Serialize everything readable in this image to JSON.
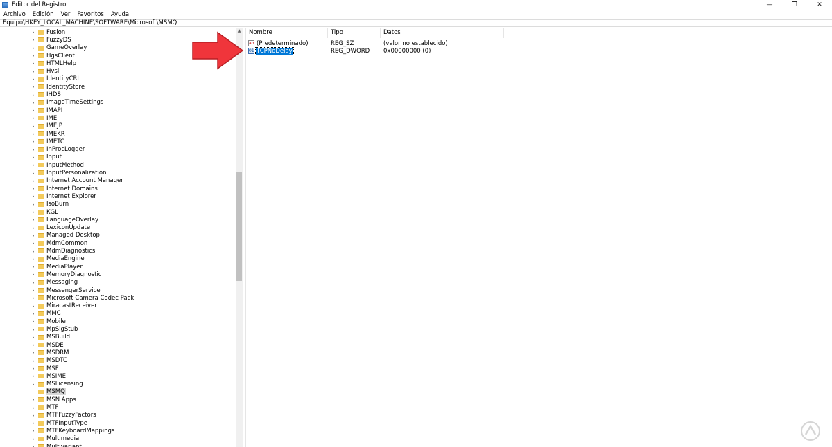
{
  "window": {
    "title": "Editor del Registro",
    "controls": [
      "—",
      "❐",
      "✕"
    ]
  },
  "menu": [
    "Archivo",
    "Edición",
    "Ver",
    "Favoritos",
    "Ayuda"
  ],
  "address": "Equipo\\HKEY_LOCAL_MACHINE\\SOFTWARE\\Microsoft\\MSMQ",
  "tree": {
    "expander": "›",
    "items": [
      "Fusion",
      "FuzzyDS",
      "GameOverlay",
      "HgsClient",
      "HTMLHelp",
      "Hvsi",
      "IdentityCRL",
      "IdentityStore",
      "IHDS",
      "ImageTimeSettings",
      "IMAPI",
      "IME",
      "IMEJP",
      "IMEKR",
      "IMETC",
      "InProcLogger",
      "Input",
      "InputMethod",
      "InputPersonalization",
      "Internet Account Manager",
      "Internet Domains",
      "Internet Explorer",
      "IsoBurn",
      "KGL",
      "LanguageOverlay",
      "LexiconUpdate",
      "Managed Desktop",
      "MdmCommon",
      "MdmDiagnostics",
      "MediaEngine",
      "MediaPlayer",
      "MemoryDiagnostic",
      "Messaging",
      "MessengerService",
      "Microsoft Camera Codec Pack",
      "MiracastReceiver",
      "MMC",
      "Mobile",
      "MpSigStub",
      "MSBuild",
      "MSDE",
      "MSDRM",
      "MSDTC",
      "MSF",
      "MSIME",
      "MSLicensing",
      "MSMQ",
      "MSN Apps",
      "MTF",
      "MTFFuzzyFactors",
      "MTFInputType",
      "MTFKeyboardMappings",
      "Multimedia",
      "Multivariant"
    ],
    "selected": "MSMQ"
  },
  "list": {
    "columns": {
      "name": "Nombre",
      "type": "Tipo",
      "data": "Datos"
    },
    "rows": [
      {
        "icon": "ab",
        "name": "(Predeterminado)",
        "type": "REG_SZ",
        "data": "(valor no establecido)"
      },
      {
        "icon": "bin",
        "name": "TCPNoDelay",
        "type": "REG_DWORD",
        "data": "0x00000000 (0)"
      }
    ],
    "selected_row": "TCPNoDelay"
  },
  "colors": {
    "selection_blue": "#0078d7",
    "annotation_arrow": "#f0353b",
    "folder_yellow": "#f3ca5b"
  }
}
